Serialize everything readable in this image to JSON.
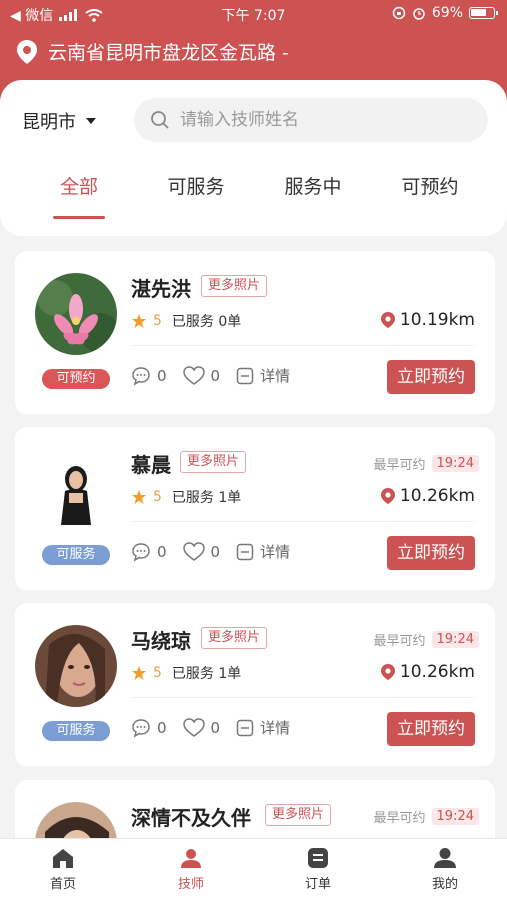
{
  "status_bar": {
    "carrier": "◀ 微信",
    "time": "下午 7:07",
    "battery": "69%"
  },
  "location": {
    "address": "云南省昆明市盘龙区金瓦路 -"
  },
  "city": "昆明市",
  "search": {
    "placeholder": "请输入技师姓名",
    "value": ""
  },
  "tabs": [
    {
      "label": "全部"
    },
    {
      "label": "可服务"
    },
    {
      "label": "服务中"
    },
    {
      "label": "可预约"
    }
  ],
  "technicians": [
    {
      "name": "湛先洪",
      "more_photos": "更多照片",
      "rating": "5",
      "served": "已服务 0单",
      "distance": "10.19km",
      "status": "可预约",
      "status_color": "#d95757",
      "earliest_label": "",
      "earliest_time": "",
      "comments": "0",
      "likes": "0",
      "detail": "详情",
      "book": "立即预约"
    },
    {
      "name": "慕晨",
      "more_photos": "更多照片",
      "rating": "5",
      "served": "已服务 1单",
      "distance": "10.26km",
      "status": "可服务",
      "status_color": "#7a9ed3",
      "earliest_label": "最早可约",
      "earliest_time": "19:24",
      "comments": "0",
      "likes": "0",
      "detail": "详情",
      "book": "立即预约"
    },
    {
      "name": "马绕琼",
      "more_photos": "更多照片",
      "rating": "5",
      "served": "已服务 1单",
      "distance": "10.26km",
      "status": "可服务",
      "status_color": "#7a9ed3",
      "earliest_label": "最早可约",
      "earliest_time": "19:24",
      "comments": "0",
      "likes": "0",
      "detail": "详情",
      "book": "立即预约"
    },
    {
      "name": "深情不及久伴",
      "more_photos": "更多照片",
      "earliest_label": "最早可约",
      "earliest_time": "19:24"
    }
  ],
  "nav": [
    {
      "label": "首页",
      "icon": "home-icon"
    },
    {
      "label": "技师",
      "icon": "technician-icon"
    },
    {
      "label": "订单",
      "icon": "order-icon"
    },
    {
      "label": "我的",
      "icon": "profile-icon"
    }
  ],
  "colors": {
    "brand": "#cd5252"
  }
}
